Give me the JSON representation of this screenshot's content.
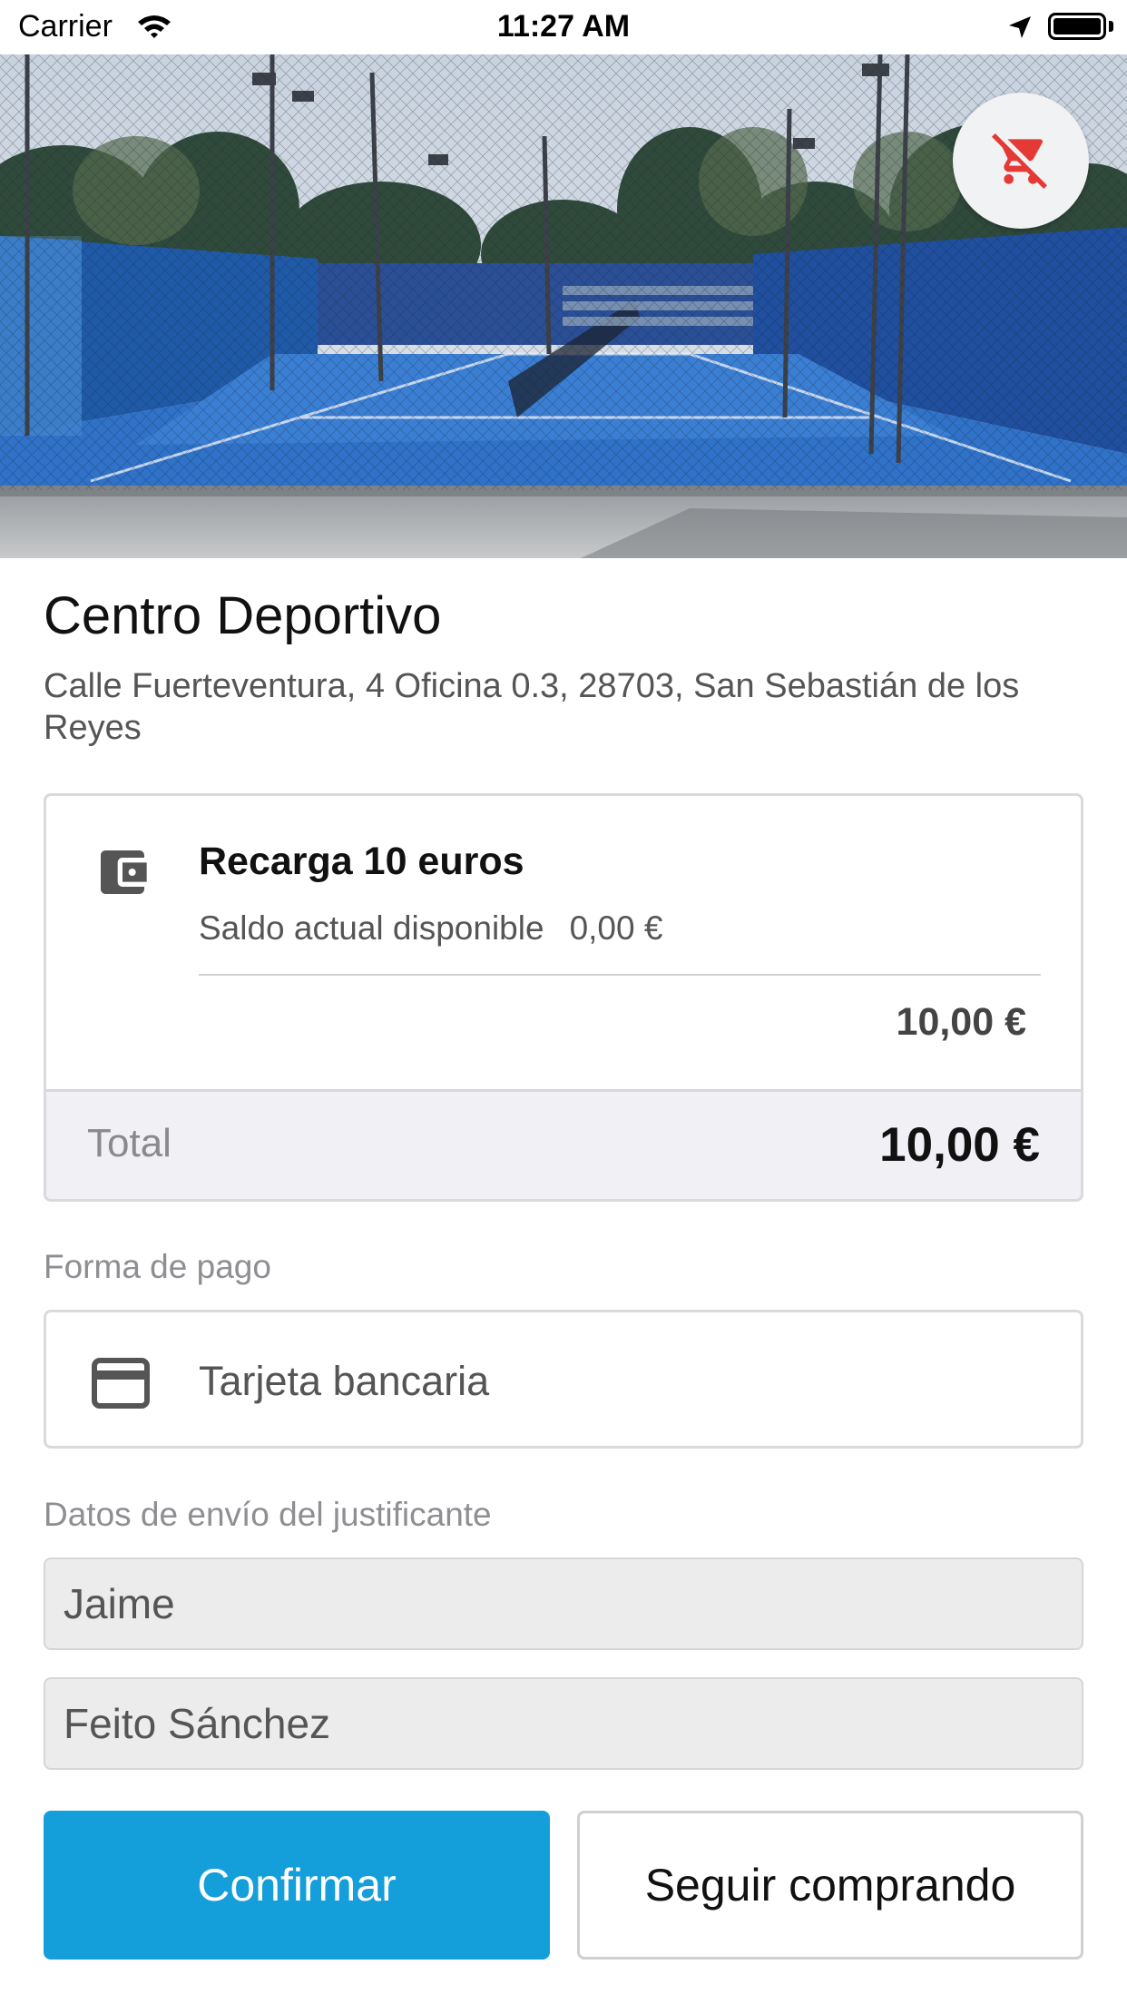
{
  "status_bar": {
    "carrier": "Carrier",
    "time": "11:27 AM"
  },
  "hero": {
    "image": "padel-courts-photo",
    "cart_icon": "remove-cart-icon",
    "cart_icon_color": "#e53935"
  },
  "venue": {
    "title": "Centro Deportivo",
    "address": "Calle Fuerteventura, 4 Oficina 0.3, 28703, San Sebastián de los Reyes"
  },
  "order": {
    "icon": "wallet-icon",
    "product_name": "Recarga 10 euros",
    "balance_label": "Saldo actual disponible",
    "balance_value": "0,00 €",
    "line_price": "10,00 €",
    "total_label": "Total",
    "total_value": "10,00 €"
  },
  "payment": {
    "section_label": "Forma de pago",
    "icon": "credit-card-icon",
    "method_label": "Tarjeta bancaria"
  },
  "receipt": {
    "section_label": "Datos de envío del justificante",
    "first_name": "Jaime",
    "last_name": "Feito Sánchez"
  },
  "actions": {
    "confirm_label": "Confirmar",
    "continue_label": "Seguir comprando"
  },
  "colors": {
    "accent": "#149fdb",
    "remove_cart": "#e53935",
    "total_row_bg": "#f0f0f5"
  }
}
